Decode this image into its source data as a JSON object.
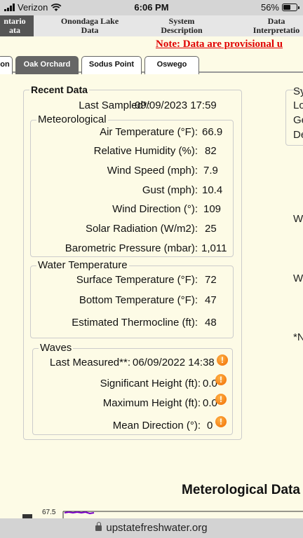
{
  "status": {
    "carrier": "Verizon",
    "time": "6:06 PM",
    "battery": "56%",
    "battery_level": 0.56
  },
  "topnav": {
    "tabs": [
      {
        "line1": "ntario",
        "line2": "ata"
      },
      {
        "line1": "Onondaga Lake",
        "line2": "Data"
      },
      {
        "line1": "System",
        "line2": "Description"
      },
      {
        "line1": "Data",
        "line2": "Interpretatio"
      }
    ],
    "notice": "Note: Data are provisional u"
  },
  "subtabs": [
    "on",
    "Oak Orchard",
    "Sodus Point",
    "Oswego"
  ],
  "recent": {
    "title": "Recent Data",
    "last_sampled_label": "Last Sampled*:",
    "last_sampled_value": "09/09/2023 17:59",
    "met": {
      "title": "Meteorological",
      "rows": [
        {
          "label": "Air Temperature (°F):",
          "value": "66.9"
        },
        {
          "label": "Relative Humidity (%):",
          "value": "82"
        },
        {
          "label": "Wind Speed (mph):",
          "value": "7.9"
        },
        {
          "label": "Gust (mph):",
          "value": "10.4"
        },
        {
          "label": "Wind Direction (°):",
          "value": "109"
        },
        {
          "label": "Solar Radiation (W/m2):",
          "value": "25"
        },
        {
          "label": "Barometric Pressure (mbar):",
          "value": "1,011"
        }
      ]
    },
    "water": {
      "title": "Water Temperature",
      "rows": [
        {
          "label": "Surface Temperature (°F):",
          "value": "72"
        },
        {
          "label": "Bottom Temperature (°F):",
          "value": "47"
        },
        {
          "label": "Estimated Thermocline (ft):",
          "value": "48"
        }
      ]
    },
    "waves": {
      "title": "Waves",
      "last_measured_label": "Last Measured**:",
      "last_measured_value": "06/09/2022 14:38",
      "rows": [
        {
          "label": "Significant Height (ft):",
          "value": "0.0"
        },
        {
          "label": "Maximum Height (ft):",
          "value": "0.0"
        },
        {
          "label": "Mean Direction (°):",
          "value": "0"
        }
      ],
      "warn_glyph": "!"
    }
  },
  "right_partial": {
    "lines": [
      "Sy",
      "Lo",
      "Ge",
      "De"
    ],
    "w1": "W",
    "w2": "W",
    "note": "*N"
  },
  "met_chart_title": "Meterological Data",
  "chart_tick": "67.5",
  "url": "upstatefreshwater.org",
  "colors": {
    "notice": "#e00000",
    "warning": "#f06a00",
    "chart_line": "#7a00c8"
  }
}
